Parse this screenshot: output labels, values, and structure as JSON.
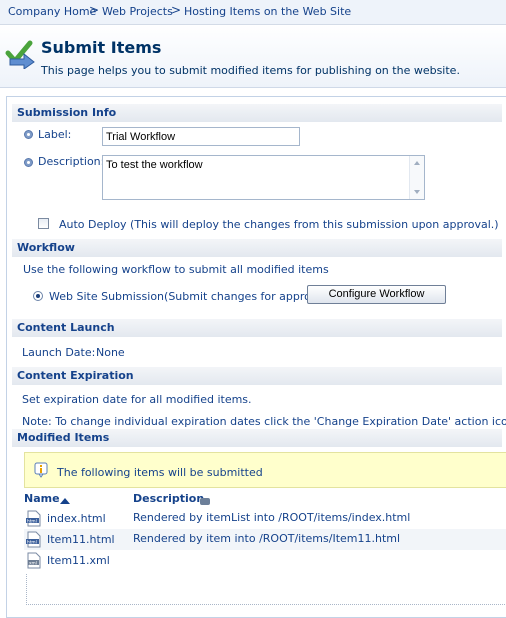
{
  "breadcrumb": {
    "items": [
      "Company Home",
      "Web Projects",
      "Hosting Items on the Web Site"
    ],
    "separator": ">"
  },
  "header": {
    "title": "Submit Items",
    "description": "This page helps you to submit modified items for publishing on the website.",
    "icon": "submit-items-check-arrow-icon"
  },
  "submission_info": {
    "heading": "Submission Info",
    "label_caption": "Label:",
    "label_value": "Trial Workflow",
    "description_caption": "Description:",
    "description_value": "To test the workflow",
    "auto_deploy_label": "Auto Deploy (This will deploy the changes from this submission upon approval.)",
    "auto_deploy_checked": false
  },
  "workflow": {
    "heading": "Workflow",
    "instruction": "Use the following workflow to submit all modified items",
    "option_label": "Web Site Submission(Submit changes for approval)",
    "option_selected": true,
    "configure_button": "Configure Workflow"
  },
  "content_launch": {
    "heading": "Content Launch",
    "launch_date_label": "Launch Date:",
    "launch_date_value": "None"
  },
  "content_expiration": {
    "heading": "Content Expiration",
    "set_text": "Set expiration date for all modified items.",
    "note": "Note: To change individual expiration dates click the 'Change Expiration Date' action icon."
  },
  "modified_items": {
    "heading": "Modified Items",
    "info_message": "The following items will be submitted",
    "columns": {
      "name": "Name",
      "description": "Description"
    },
    "rows": [
      {
        "name": "index.html",
        "description": "Rendered by itemList into /ROOT/items/index.html",
        "icon": "html-file-icon"
      },
      {
        "name": "Item11.html",
        "description": "Rendered by item into /ROOT/items/Item11.html",
        "icon": "html-file-icon"
      },
      {
        "name": "Item11.xml",
        "description": "",
        "icon": "xml-file-icon"
      }
    ]
  },
  "colors": {
    "link_blue": "#15428b",
    "header_bg": "#eef3fa",
    "info_bg": "#ffffcc"
  }
}
